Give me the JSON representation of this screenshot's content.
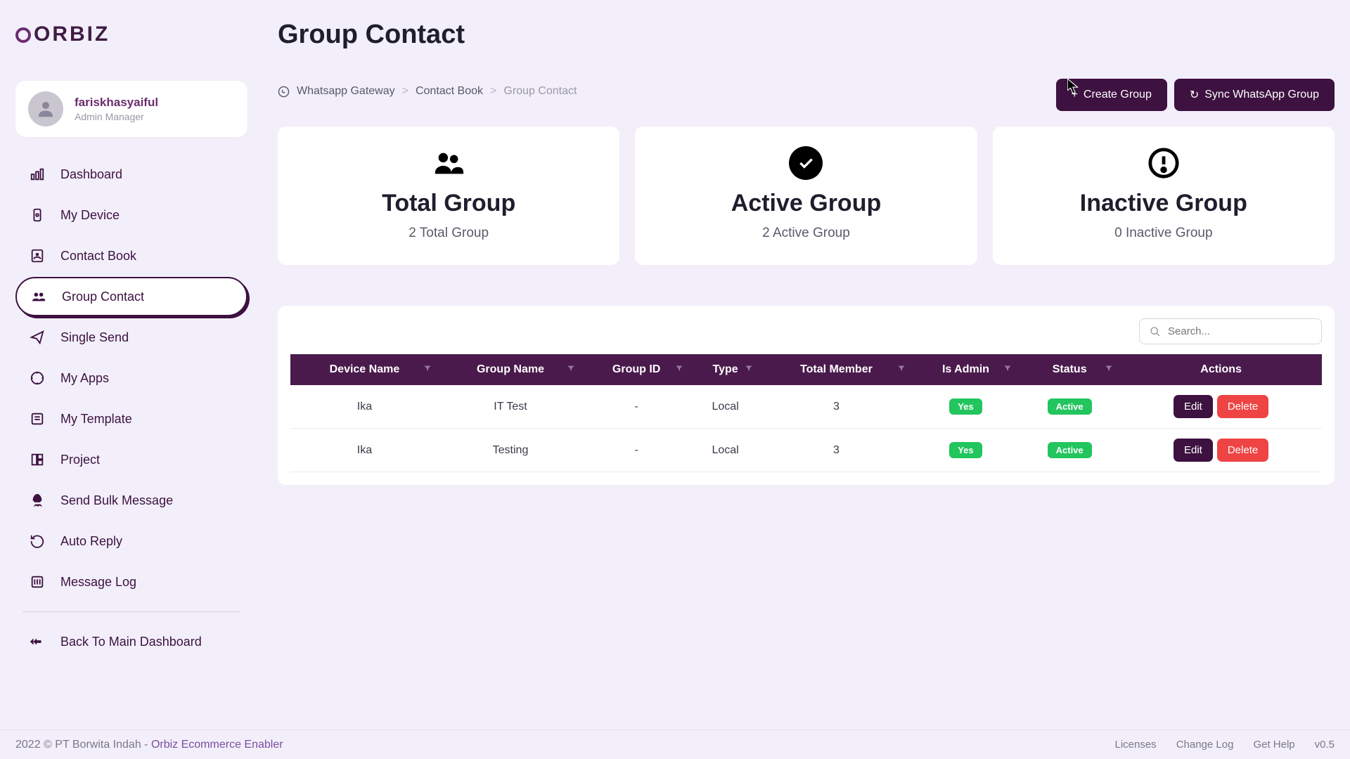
{
  "brand": "ORBIZ",
  "page_title": "Group Contact",
  "user": {
    "name": "fariskhasyaiful",
    "role": "Admin Manager"
  },
  "sidebar": {
    "items": [
      {
        "label": "Dashboard",
        "icon": "chart"
      },
      {
        "label": "My Device",
        "icon": "device"
      },
      {
        "label": "Contact Book",
        "icon": "contact"
      },
      {
        "label": "Group Contact",
        "icon": "group",
        "active": true
      },
      {
        "label": "Single Send",
        "icon": "send"
      },
      {
        "label": "My Apps",
        "icon": "apps"
      },
      {
        "label": "My Template",
        "icon": "template"
      },
      {
        "label": "Project",
        "icon": "project"
      },
      {
        "label": "Send Bulk Message",
        "icon": "rocket"
      },
      {
        "label": "Auto Reply",
        "icon": "reply"
      },
      {
        "label": "Message Log",
        "icon": "log"
      }
    ],
    "footer_link": "Back To Main Dashboard"
  },
  "breadcrumb": {
    "root_icon": "whatsapp",
    "items": [
      "Whatsapp Gateway",
      "Contact Book",
      "Group Contact"
    ]
  },
  "buttons": {
    "create": "Create Group",
    "sync": "Sync WhatsApp Group"
  },
  "cards": [
    {
      "title": "Total Group",
      "sub": "2 Total Group",
      "icon": "users"
    },
    {
      "title": "Active Group",
      "sub": "2 Active Group",
      "icon": "check"
    },
    {
      "title": "Inactive Group",
      "sub": "0 Inactive Group",
      "icon": "alert"
    }
  ],
  "search": {
    "placeholder": "Search..."
  },
  "table": {
    "columns": [
      "Device Name",
      "Group Name",
      "Group ID",
      "Type",
      "Total Member",
      "Is Admin",
      "Status",
      "Actions"
    ],
    "rows": [
      {
        "device": "Ika",
        "group": "IT Test",
        "gid": "-",
        "type": "Local",
        "members": "3",
        "admin": "Yes",
        "status": "Active"
      },
      {
        "device": "Ika",
        "group": "Testing",
        "gid": "-",
        "type": "Local",
        "members": "3",
        "admin": "Yes",
        "status": "Active"
      }
    ],
    "edit": "Edit",
    "delete": "Delete"
  },
  "footer": {
    "copyright": "2022 © PT Borwita Indah - ",
    "brand_link": "Orbiz Ecommerce Enabler",
    "links": [
      "Licenses",
      "Change Log",
      "Get Help",
      "v0.5"
    ]
  }
}
